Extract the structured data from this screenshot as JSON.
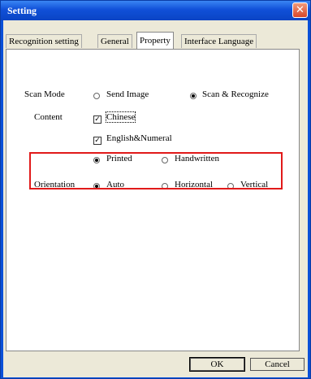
{
  "window": {
    "title": "Setting",
    "close_glyph": "✕"
  },
  "tabs": [
    {
      "label": "Recognition setting"
    },
    {
      "label": "General"
    },
    {
      "label": "Property"
    },
    {
      "label": "Interface Language"
    }
  ],
  "scan_mode": {
    "label": "Scan Mode",
    "options": [
      {
        "label": "Send Image",
        "selected": false
      },
      {
        "label": "Scan & Recognize",
        "selected": true
      }
    ]
  },
  "content": {
    "label": "Content",
    "checkboxes": [
      {
        "label": "Chinese",
        "checked": true
      },
      {
        "label": "English&Numeral",
        "checked": true
      }
    ],
    "text_type": [
      {
        "label": "Printed",
        "selected": true
      },
      {
        "label": "Handwritten",
        "selected": false
      }
    ]
  },
  "orientation": {
    "label": "Orientation",
    "options": [
      {
        "label": "Auto",
        "selected": true
      },
      {
        "label": "Horizontal",
        "selected": false
      },
      {
        "label": "Vertical",
        "selected": false
      }
    ]
  },
  "buttons": {
    "ok": "OK",
    "cancel": "Cancel"
  },
  "colors": {
    "title_bar": "#1050d8",
    "highlight_box": "#e11a1a",
    "dialog_bg": "#ece9d8"
  },
  "checkmark_glyph": "✓"
}
